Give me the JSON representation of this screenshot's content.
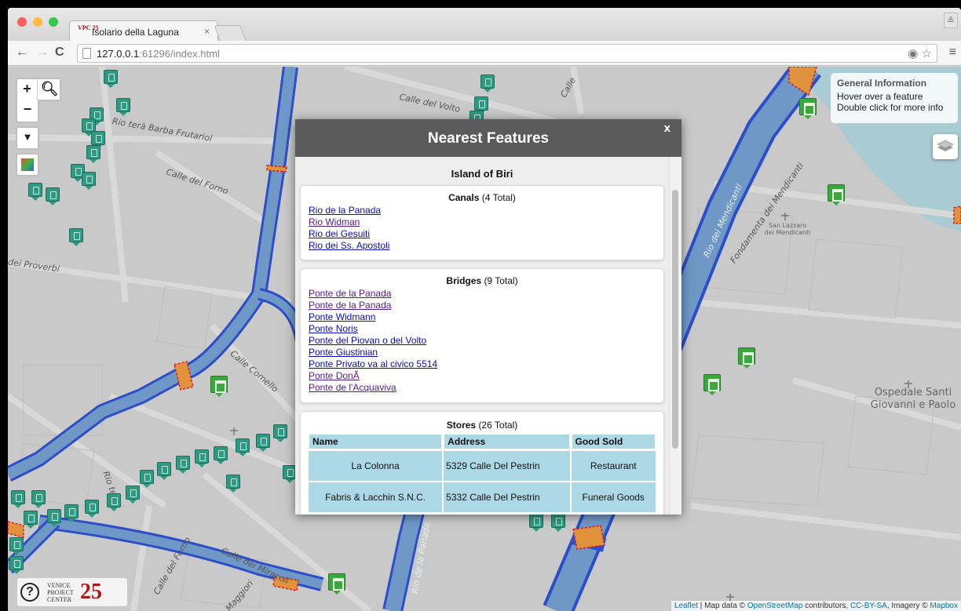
{
  "browser": {
    "tab_title": "Isolario della Laguna",
    "tab_favicon": "VPC 25",
    "url_host": "127.0.0.1",
    "url_rest": ":61296/index.html"
  },
  "map": {
    "street_labels": [
      "Calle del Volto",
      "Rio terà Barba Frutariol",
      "Calle del Forno",
      "dei Proverbi",
      "Calle Comello",
      "Calle dei Miracoli",
      "Calle del Forno",
      "Rio de la Panada",
      "Fondamenta dei Mendicanti",
      "Rio dei Mendicanti",
      "Calle",
      "Calle Maggiori",
      "Rio terà",
      "Ospedale Santi Giovanni e Paolo",
      "San Lazzaro dei Mendicanti"
    ],
    "hospital": "Ospedale Santi\nGiovanni e Paolo",
    "lazzaro": "San Lazzaro\ndei Mendicanti"
  },
  "controls": {
    "zoom_in": "+",
    "zoom_out": "−",
    "search": "⚲",
    "filter": "▼"
  },
  "info": {
    "heading": "General Information",
    "line1": "Hover over a feature",
    "line2": "Double click for more info"
  },
  "attribution": {
    "leaflet": "Leaflet",
    "sep": " | Map data © ",
    "osm": "OpenStreetMap",
    "contrib": " contributors, ",
    "license": "CC-BY-SA",
    "imagery": ", Imagery © ",
    "mapbox": "Mapbox"
  },
  "logo": {
    "text": "VENICE\nPROJECT\nCENTER",
    "number": "25",
    "help": "?"
  },
  "modal": {
    "title": "Nearest Features",
    "close": "x",
    "island": "Island of Biri",
    "canals_heading": "Canals",
    "canals_total": "(4 Total)",
    "canals": [
      "Rio de la Panada",
      "Rio Widman",
      "Rio dei Gesuiti",
      "Rio dei Ss. Apostoli"
    ],
    "bridges_heading": "Bridges",
    "bridges_total": "(9 Total)",
    "bridges": [
      "Ponte de la Panada",
      "Ponte de la Panada",
      "Ponte Widmann",
      "Ponte Noris",
      "Ponte del Piovan o del Volto",
      "Ponte Giustinian",
      "Ponte Privato va al civico 5514",
      "Ponte DonÃ",
      "Ponte de l'Acquaviva"
    ],
    "stores_heading": "Stores",
    "stores_total": "(26 Total)",
    "stores_columns": [
      "Name",
      "Address",
      "Good Sold"
    ],
    "stores": [
      {
        "name": "La Colonna",
        "address": "5329 Calle Del Pestrin",
        "good": "Restaurant"
      },
      {
        "name": "Fabris & Lacchin S.N.C.",
        "address": "5332 Calle Del Pestrin",
        "good": "Funeral Goods"
      }
    ]
  }
}
